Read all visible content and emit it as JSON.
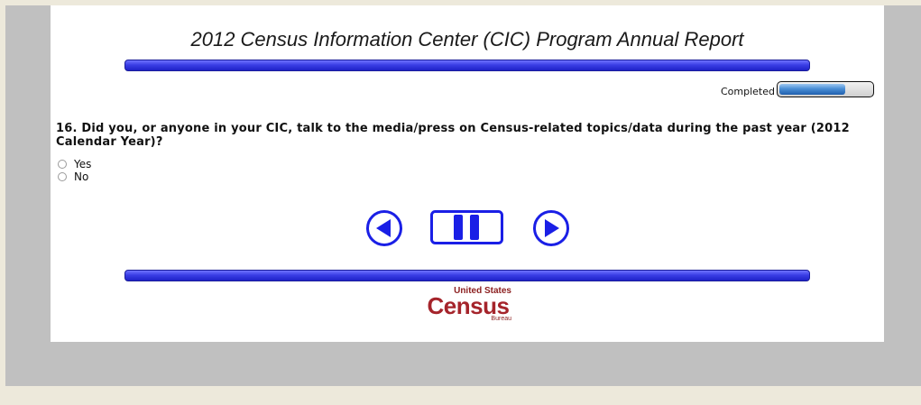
{
  "survey": {
    "title": "2012 Census Information Center (CIC) Program Annual Report",
    "progress": {
      "label": "Completed",
      "fraction": 0.72
    },
    "question": {
      "text": "16. Did you, or anyone in your CIC, talk to the media/press on Census-related topics/data during the past year (2012 Calendar Year)?",
      "options": [
        "Yes",
        "No"
      ]
    },
    "nav": {
      "back_icon": "back-arrow-icon",
      "pause_icon": "pause-icon",
      "next_icon": "next-arrow-icon"
    },
    "footer_logo": {
      "top": "United States",
      "main": "Census",
      "bottom": "Bureau"
    }
  },
  "colors": {
    "page_bg": "#ede9db",
    "frame_bg": "#c0c0c0",
    "bar_blue": "#3a3ee6",
    "nav_blue": "#1a1fe6",
    "logo_red": "#a5242b"
  }
}
